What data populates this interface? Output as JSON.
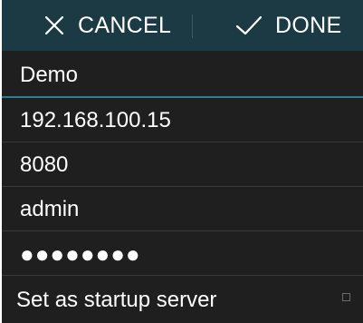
{
  "toolbar": {
    "cancel_label": "CANCEL",
    "done_label": "DONE"
  },
  "form": {
    "name": "Demo",
    "host": "192.168.100.15",
    "port": "8080",
    "username": "admin",
    "password_mask": "●●●●●●●●"
  },
  "startup": {
    "label": "Set as startup server",
    "checked": false
  },
  "colors": {
    "action_bar": "#1b3a44",
    "background": "#1f1f1f",
    "focus_underline": "#2f7d93",
    "text": "#ffffff"
  }
}
